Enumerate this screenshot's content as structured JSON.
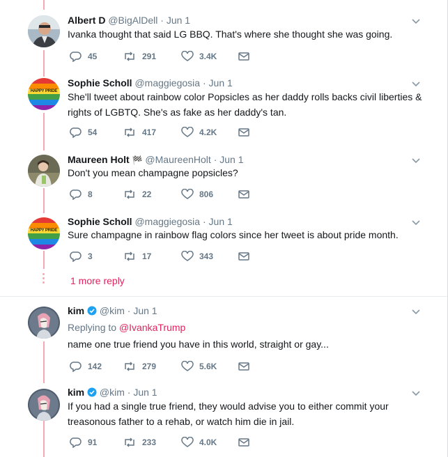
{
  "tweets": [
    {
      "name": "Albert D",
      "handle": "@BigAlDell",
      "date": "Jun 1",
      "text": "Ivanka thought that said LG BBQ. That's where she thought she was going.",
      "replies": "45",
      "retweets": "291",
      "likes": "3.4K",
      "avatar": "albert-photo"
    },
    {
      "name": "Sophie Scholl",
      "handle": "@maggiegosia",
      "date": "Jun 1",
      "text": "She'll tweet about rainbow color Popsicles as her daddy rolls backs civil liberties & rights of LGBTQ.  She's as fake as her daddy's tan.",
      "replies": "54",
      "retweets": "417",
      "likes": "4.2K",
      "avatar": "happy-pride",
      "avatar_text": "HAPPY PRIDE"
    },
    {
      "name": "Maureen Holt",
      "name_suffix": "🏁",
      "handle": "@MaureenHolt",
      "date": "Jun 1",
      "text": "Don't you mean champagne popsicles?",
      "replies": "8",
      "retweets": "22",
      "likes": "806",
      "avatar": "maureen-photo"
    },
    {
      "name": "Sophie Scholl",
      "handle": "@maggiegosia",
      "date": "Jun 1",
      "text": "Sure champagne in rainbow flag colors since her tweet is about pride month.",
      "replies": "3",
      "retweets": "17",
      "likes": "343",
      "avatar": "happy-pride",
      "avatar_text": "HAPPY PRIDE"
    },
    {
      "name": "kim",
      "handle": "@kim",
      "date": "Jun 1",
      "replying_label": "Replying to",
      "replying_to": "@IvankaTrump",
      "text": "name one true friend you have in this world, straight or gay...",
      "replies": "142",
      "retweets": "279",
      "likes": "5.6K",
      "avatar": "kim-illustration",
      "verified": true
    },
    {
      "name": "kim",
      "handle": "@kim",
      "date": "Jun 1",
      "text": "If you had a single true friend, they would advise you to either commit your treasonous father to a rehab, or watch him die in jail.",
      "replies": "91",
      "retweets": "233",
      "likes": "4.0K",
      "avatar": "kim-illustration",
      "verified": true
    }
  ],
  "more_replies": "1 more reply",
  "dot_sep": "·",
  "colors": {
    "thread": "#f6a6b4",
    "accent": "#e0245e",
    "muted": "#657786",
    "verified": "#1da1f2"
  }
}
